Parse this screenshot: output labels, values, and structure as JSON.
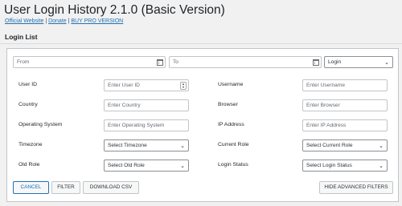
{
  "header": {
    "title": "User Login History 2.1.0 (Basic Version)",
    "link_official": "Official Website",
    "sep1": " | ",
    "link_donate": "Donate",
    "sep2": " | ",
    "link_pro": "BUY PRO VERSION"
  },
  "section": {
    "title": "Login List"
  },
  "date_range": {
    "from_placeholder": "From",
    "to_placeholder": "To",
    "type_select": "Login"
  },
  "fields": {
    "user_id": {
      "label": "User ID",
      "placeholder": "Enter User ID"
    },
    "username": {
      "label": "Username",
      "placeholder": "Enter Username"
    },
    "country": {
      "label": "Country",
      "placeholder": "Enter Country"
    },
    "browser": {
      "label": "Browser",
      "placeholder": "Enter Browser"
    },
    "os": {
      "label": "Operating System",
      "placeholder": "Enter Operating System"
    },
    "ip": {
      "label": "IP Address",
      "placeholder": "Enter IP Address"
    },
    "timezone": {
      "label": "Timezone",
      "value": "Select Timezone"
    },
    "current_role": {
      "label": "Current Role",
      "value": "Select Current Role"
    },
    "old_role": {
      "label": "Old Role",
      "value": "Select Old Role"
    },
    "login_status": {
      "label": "Login Status",
      "value": "Select Login Status"
    }
  },
  "buttons": {
    "cancel": "CANCEL",
    "filter": "FILTER",
    "download_csv": "DOWNLOAD CSV",
    "hide_advanced": "HIDE ADVANCED FILTERS"
  },
  "icons": {
    "calendar": "calendar-icon",
    "chevron": "chevron-down-icon",
    "spinner": "number-spinner-icon"
  },
  "colors": {
    "link": "#2271b1",
    "page_bg": "#f1f1f1",
    "panel_bg": "#ffffff"
  }
}
